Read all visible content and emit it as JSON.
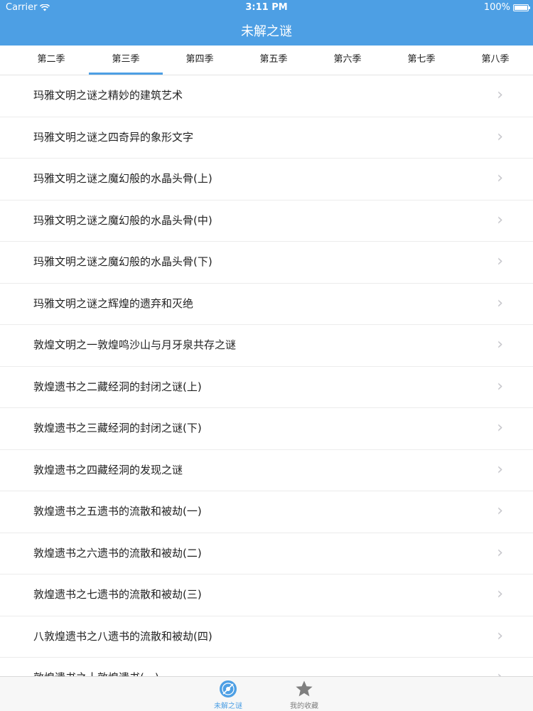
{
  "status_bar": {
    "carrier": "Carrier",
    "time": "3:11 PM",
    "battery": "100%"
  },
  "nav": {
    "title": "未解之谜"
  },
  "tabs": [
    {
      "label": "第二季"
    },
    {
      "label": "第三季"
    },
    {
      "label": "第四季"
    },
    {
      "label": "第五季"
    },
    {
      "label": "第六季"
    },
    {
      "label": "第七季"
    },
    {
      "label": "第八季"
    }
  ],
  "selected_tab": "第三季",
  "list": {
    "items": [
      {
        "title": "玛雅文明之谜之精妙的建筑艺术"
      },
      {
        "title": "玛雅文明之谜之四奇异的象形文字"
      },
      {
        "title": "玛雅文明之谜之魔幻般的水晶头骨(上)"
      },
      {
        "title": "玛雅文明之谜之魔幻般的水晶头骨(中)"
      },
      {
        "title": "玛雅文明之谜之魔幻般的水晶头骨(下)"
      },
      {
        "title": "玛雅文明之谜之辉煌的遗弃和灭绝"
      },
      {
        "title": "敦煌文明之一敦煌鸣沙山与月牙泉共存之谜"
      },
      {
        "title": "敦煌遗书之二藏经洞的封闭之谜(上)"
      },
      {
        "title": "敦煌遗书之三藏经洞的封闭之谜(下)"
      },
      {
        "title": "敦煌遗书之四藏经洞的发现之谜"
      },
      {
        "title": "敦煌遗书之五遗书的流散和被劫(一)"
      },
      {
        "title": "敦煌遗书之六遗书的流散和被劫(二)"
      },
      {
        "title": "敦煌遗书之七遗书的流散和被劫(三)"
      },
      {
        "title": "八敦煌遗书之八遗书的流散和被劫(四)"
      },
      {
        "title": "敦煌遗书之十敦煌遗书(一)"
      }
    ]
  },
  "tabbar": {
    "items": [
      {
        "label": "未解之谜",
        "icon": "disc-icon",
        "active": true
      },
      {
        "label": "我的收藏",
        "icon": "star-icon",
        "active": false
      }
    ]
  },
  "colors": {
    "accent": "#4d9fe4",
    "inactive": "#7f7f7f",
    "chevron": "#c7c7cc"
  }
}
